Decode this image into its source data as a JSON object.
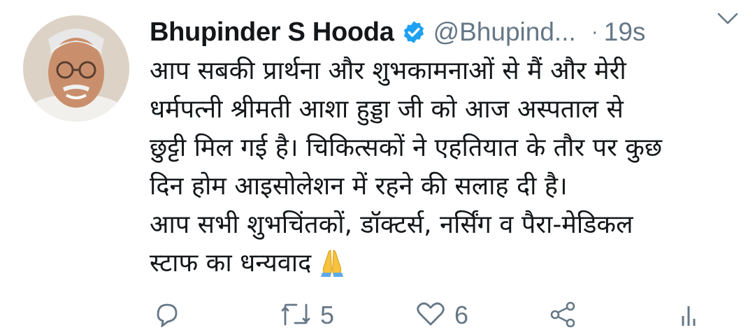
{
  "tweet": {
    "author_name": "Bhupinder S Hooda",
    "handle": "@Bhupind...",
    "separator": "·",
    "timestamp": "19s",
    "lines": [
      "आप सबकी प्रार्थना और शुभकामनाओं से मैं और मेरी",
      "धर्मपत्नी श्रीमती आशा हुड्डा जी को आज अस्पताल से",
      "छुट्टी मिल गई है। चिकित्सकों ने एहतियात के तौर पर कुछ",
      "दिन होम आइसोलेशन में रहने की सलाह दी है।",
      "आप सभी शुभचिंतकों, डॉक्टर्स, नर्सिंग व पैरा-मेडिकल",
      "स्टाफ का धन्यवाद"
    ],
    "emoji": "folded-hands",
    "retweet_count": "5",
    "like_count": "6"
  },
  "icons": {
    "verified": "verified-badge-icon",
    "caret": "chevron-down-icon",
    "reply": "reply-icon",
    "retweet": "retweet-icon",
    "like": "heart-icon",
    "share": "share-icon",
    "analytics": "analytics-icon"
  },
  "colors": {
    "text": "#14171a",
    "secondary": "#657786",
    "verified_blue": "#1da1f2"
  }
}
